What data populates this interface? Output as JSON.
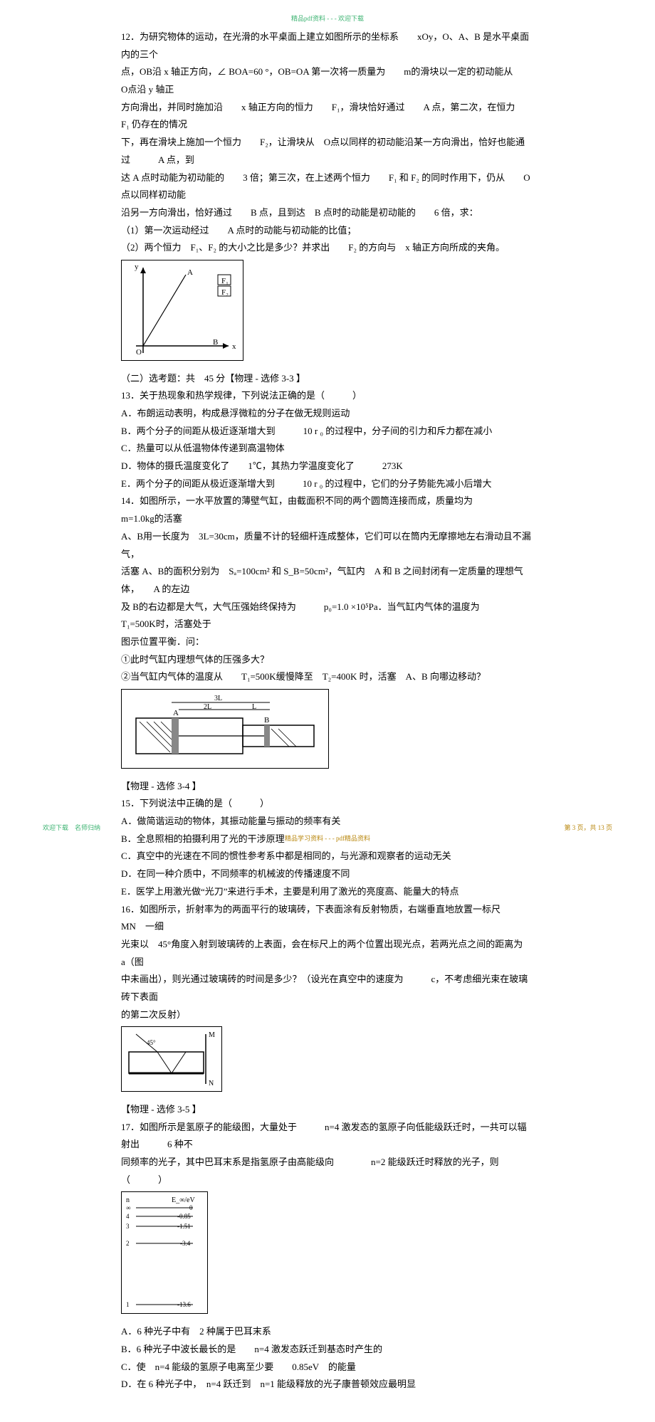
{
  "header": "精品pdf资料 - - - 欢迎下载",
  "q12": {
    "l1": "12．为研究物体的运动，在光滑的水平桌面上建立如图所示的坐标系　　xOy，O、A、B 是水平桌面内的三个",
    "l2": "点，OB沿 x 轴正方向，∠ BOA=60 °，OB=OA 第一次将一质量为　　m的滑块以一定的初动能从　　O点沿 y 轴正",
    "l3": "方向滑出，并同时施加沿　　x 轴正方向的恒力　　F₁，滑块恰好通过　　A 点，第二次，在恒力　　F₁ 仍存在的情况",
    "l4": "下，再在滑块上施加一个恒力　　F₂，让滑块从　O点以同样的初动能沿某一方向滑出，恰好也能通过　　　A 点，到",
    "l5": "达 A 点时动能为初动能的　　3 倍；第三次，在上述两个恒力　　F₁ 和 F₂ 的同时作用下，仍从　　O点以同样初动能",
    "l6": "沿另一方向滑出，恰好通过　　B 点，且到达　B 点时的动能是初动能的　　6 倍，求：",
    "l7": "（1）第一次运动经过　　A 点时的动能与初动能的比值；",
    "l8": "（2）两个恒力　F₁、F₂ 的大小之比是多少？并求出　　F₂ 的方向与　x 轴正方向所成的夹角。"
  },
  "section2": "（二）选考题：共　45 分【物理 - 选修 3-3 】",
  "q13": {
    "l1": "13．关于热现象和热学规律，下列说法正确的是（　　　）",
    "a": "A．布朗运动表明，构成悬浮微粒的分子在做无规则运动",
    "b": "B．两个分子的间距从极近逐渐增大到　　　10 r ₀ 的过程中，分子间的引力和斥力都在减小",
    "c": "C．热量可以从低温物体传递到高温物体",
    "d": "D．物体的摄氏温度变化了　　1℃，其热力学温度变化了　　　273K",
    "e": "E．两个分子的间距从极近逐渐增大到　　　10 r ₀ 的过程中，它们的分子势能先减小后增大"
  },
  "q14": {
    "l1": "14．如图所示，一水平放置的薄壁气缸，由截面积不同的两个圆筒连接而成，质量均为　　　　　m=1.0kg的活塞",
    "l2": "A、B用一长度为　3L=30cm，质量不计的轻细杆连成整体，它们可以在筒内无摩擦地左右滑动且不漏气，",
    "l3": "活塞 A、B的面积分别为　Sₐ=100cm² 和 S_B=50cm²，气缸内　A 和 B 之间封闭有一定质量的理想气体，　　A 的左边",
    "l4": "及 B的右边都是大气，大气压强始终保持为　　　p₀=1.0 ×10⁵Pa．当气缸内气体的温度为　　　T₁=500K时，活塞处于",
    "l5": "图示位置平衡．问：",
    "l6": "①此时气缸内理想气体的压强多大？",
    "l7": "②当气缸内气体的温度从　　T₁=500K缓慢降至　T₂=400K 时，活塞　A、B 向哪边移动？"
  },
  "section34": "【物理 - 选修 3-4 】",
  "q15": {
    "l1": "15．下列说法中正确的是（　　　）",
    "a": "A．做简谐运动的物体，其振动能量与振动的频率有关",
    "b": "B．全息照相的拍摄利用了光的干涉原理",
    "c": "C．真空中的光速在不同的惯性参考系中都是相同的，与光源和观察者的运动无关",
    "d": "D．在同一种介质中，不同频率的机械波的传播速度不同",
    "e": "E．医学上用激光做“光刀”来进行手术，主要是利用了激光的亮度高、能量大的特点"
  },
  "q16": {
    "l1": "16．如图所示，折射率为的两面平行的玻璃砖，下表面涂有反射物质，右端垂直地放置一标尺　　　　MN　一细",
    "l2": "光束以　45°角度入射到玻璃砖的上表面，会在标尺上的两个位置出现光点，若两光点之间的距离为　　　　　a（图",
    "l3": "中未画出），则光通过玻璃砖的时间是多少？（设光在真空中的速度为　　　c，不考虑细光束在玻璃砖下表面",
    "l4": "的第二次反射）"
  },
  "section35": "【物理 - 选修 3-5 】",
  "q17": {
    "l1": "17．如图所示是氢原子的能级图，大量处于　　　n=4 激发态的氢原子向低能级跃迁时，一共可以辐射出　　　6 种不",
    "l2": "同频率的光子，其中巴耳末系是指氢原子由高能级向　　　　n=2 能级跃迁时释放的光子，则（　　　）",
    "a": "A．6 种光子中有　2 种属于巴耳末系",
    "b": "B．6 种光子中波长最长的是　　n=4 激发态跃迁到基态时产生的",
    "c": "C．使　n=4 能级的氢原子电离至少要　　0.85eV　的能量",
    "d": "D．在 6 种光子中，　n=4 跃迁到　n=1 能级释放的光子康普顿效应最明显"
  },
  "energy_labels": {
    "n": "n",
    "EeV": "E_∞/eV",
    "inf": "∞",
    "v0": "0",
    "n4": "4",
    "e4": "-0.85",
    "n3": "3",
    "e3": "-1.51",
    "n2": "2",
    "e2": "-3.4",
    "n1": "1",
    "e1": "-13.6"
  },
  "fig14_labels": {
    "A": "A",
    "B": "B",
    "L3": "3L",
    "L2": "2L",
    "L": "L"
  },
  "footer_left": "欢迎下载　名师归纳",
  "footer_right": "第 3 页，共 13 页",
  "footer_center": "精品学习资料 - - - pdf精品资料"
}
